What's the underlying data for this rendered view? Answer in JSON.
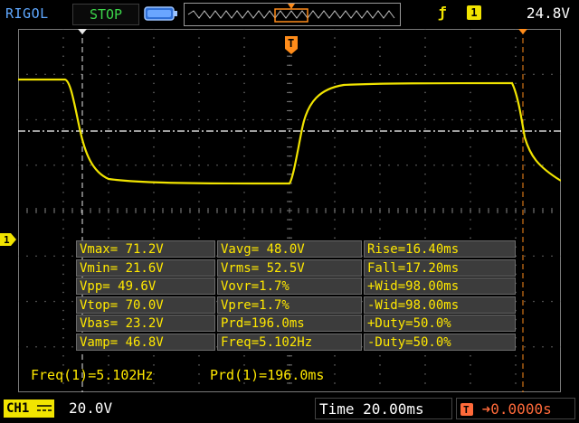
{
  "topbar": {
    "brand": "RIGOL",
    "run_state": "STOP",
    "trigger_source": "1",
    "trigger_edge_symbol": "ƒ",
    "trigger_level": "24.8V"
  },
  "trigger_marker_label": "T",
  "channel_marker_label": "1",
  "measurements": {
    "rows": [
      [
        "Vmax= 71.2V",
        "Vavg= 48.0V",
        "Rise=16.40ms"
      ],
      [
        "Vmin= 21.6V",
        "Vrms= 52.5V",
        "Fall=17.20ms"
      ],
      [
        "Vpp= 49.6V",
        "Vovr=1.7%",
        "+Wid=98.00ms"
      ],
      [
        "Vtop= 70.0V",
        "Vpre=1.7%",
        "-Wid=98.00ms"
      ],
      [
        "Vbas= 23.2V",
        "Prd=196.0ms",
        "+Duty=50.0%"
      ],
      [
        "Vamp= 46.8V",
        "Freq=5.102Hz",
        "-Duty=50.0%"
      ]
    ]
  },
  "counter": {
    "freq": "Freq(1)=5.102Hz",
    "period": "Prd(1)=196.0ms"
  },
  "bottombar": {
    "channel_label": "CH1",
    "channel_scale": "20.0V",
    "timebase": "Time 20.00ms",
    "trigger_offset": "0.0000s"
  },
  "colors": {
    "trace": "#f1e400",
    "grid": "#5a5a5a",
    "trigger_marker": "#ff8c1a",
    "brand": "#5fa8ff",
    "run_state": "#3cd64a"
  }
}
